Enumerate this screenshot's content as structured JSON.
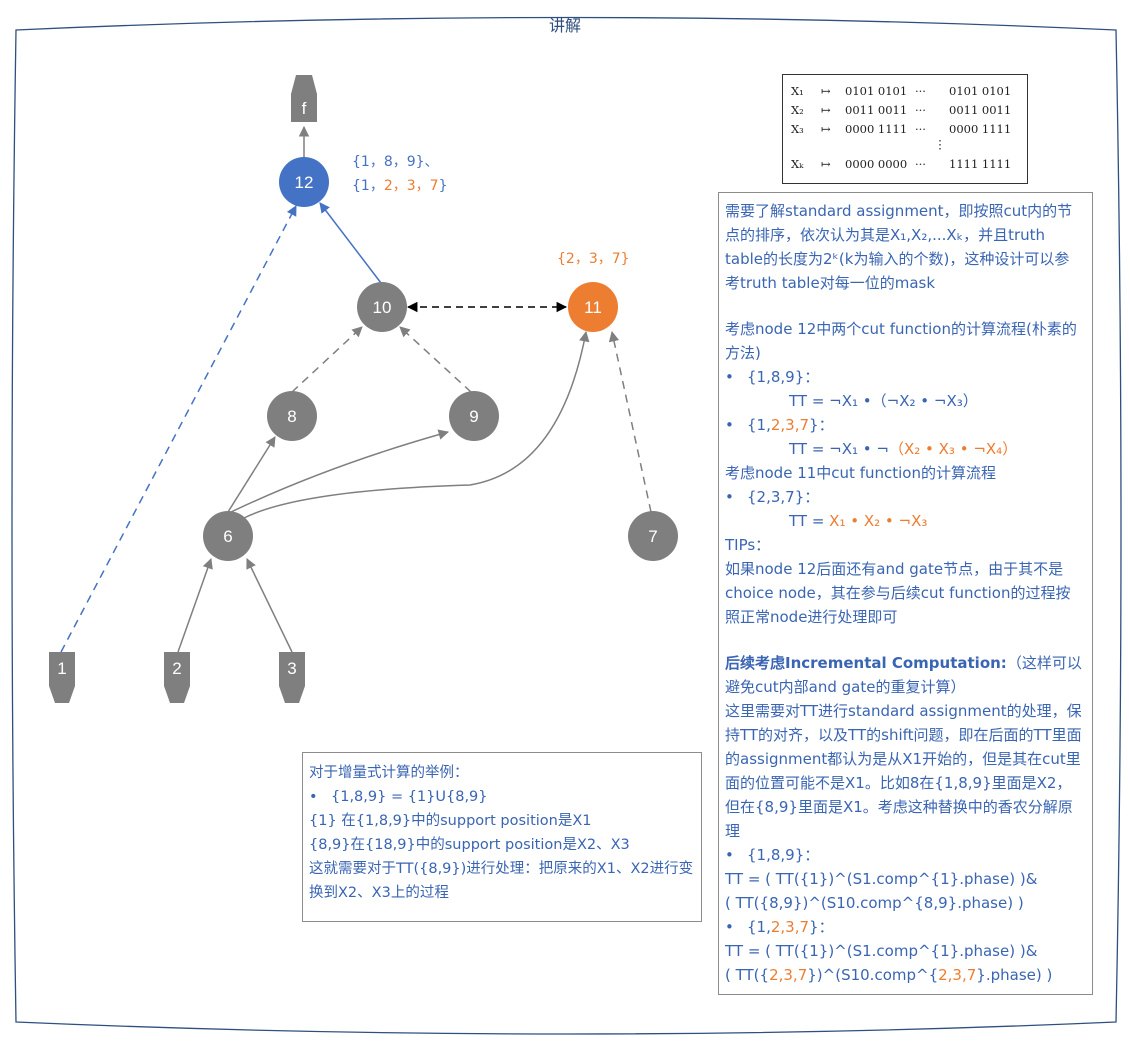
{
  "frame_title": "讲解",
  "graph": {
    "nodes": {
      "n12": "12",
      "n10": "10",
      "n11": "11",
      "n8": "8",
      "n9": "9",
      "n6": "6",
      "n7": "7",
      "i1": "1",
      "i2": "2",
      "i3": "3",
      "out": "f"
    },
    "cut_labels": {
      "cut12_a": "{1，8，9}、",
      "cut12_b_prefix": "{1，",
      "cut12_b_highlight": "2，3，7",
      "cut12_b_suffix": "}",
      "cut11": "{2，3，7}"
    }
  },
  "truth_table": {
    "rows": [
      {
        "var": "X₁",
        "arrow": "↦",
        "a": "0101 0101",
        "dots": "···",
        "b": "0101 0101"
      },
      {
        "var": "X₂",
        "arrow": "↦",
        "a": "0011 0011",
        "dots": "···",
        "b": "0011 0011"
      },
      {
        "var": "X₃",
        "arrow": "↦",
        "a": "0000 1111",
        "dots": "···",
        "b": "0000 1111"
      },
      {
        "var": "",
        "arrow": "",
        "a": "",
        "dots": "⋮",
        "b": ""
      },
      {
        "var": "Xₖ",
        "arrow": "↦",
        "a": "0000 0000",
        "dots": "···",
        "b": "1111 1111"
      }
    ]
  },
  "explanation": {
    "p1": "需要了解standard assignment，即按照cut内的节点的排序，依次认为其是X₁,X₂,...Xₖ，并且truth table的长度为2ᵏ(k为输入的个数)，这种设计可以参考truth table对每一位的mask",
    "p2": "考虑node 12中两个cut function的计算流程(朴素的方法)",
    "b1": "{1,8,9}：",
    "tt1": "TT =  ¬X₁ •（¬X₂ • ¬X₃）",
    "b2_prefix": "{1,",
    "b2_hl": "2,3,7",
    "b2_suffix": "}：",
    "tt2_prefix": "TT =  ¬X₁ • ¬",
    "tt2_hl": "（X₂ • X₃ • ¬X₄）",
    "p3": "考虑node 11中cut function的计算流程",
    "b3": "{2,3,7}：",
    "tt3_prefix": "TT = ",
    "tt3_hl": "X₁ • X₂ • ¬X₃",
    "tips": "TIPs：",
    "p4": "如果node 12后面还有and gate节点，由于其不是choice node，其在参与后续cut function的过程按照正常node进行处理即可",
    "p5_bold": "后续考虑Incremental Computation:",
    "p5_rest": "（这样可以避免cut内部and gate的重复计算）",
    "p6": "这里需要对TT进行standard assignment的处理，保持TT的对齐，以及TT的shift问题，即在后面的TT里面的assignment都认为是从X1开始的，但是其在cut里面的位置可能不是X1。比如8在{1,8,9}里面是X2，但在{8,9}里面是X1。考虑这种替换中的香农分解原理",
    "b4": "{1,8,9}：",
    "f1a": "TT = ( TT({1})^(S1.comp^{1}.phase) )&",
    "f1b": "( TT({8,9})^(S10.comp^{8,9}.phase) )",
    "b5_prefix": "{1,",
    "b5_hl": "2,3,7",
    "b5_suffix": "}：",
    "f2a": "TT = ( TT({1})^(S1.comp^{1}.phase) )&",
    "f2b_prefix": "( TT({",
    "f2b_hl1": "2,3,7",
    "f2b_mid": "})^(S10.comp^{",
    "f2b_hl2": "2,3,7",
    "f2b_suffix": "}.phase) )"
  },
  "example": {
    "l1": "对于增量式计算的举例：",
    "l2": "{1,8,9} = {1}U{8,9}",
    "l3": "{1} 在{1,8,9}中的support position是X1",
    "l4": "{8,9}在{18,9}中的support position是X2、X3",
    "l5": "这就需要对于TT({8,9})进行处理：把原来的X1、X2进行变换到X2、X3上的过程"
  },
  "colors": {
    "blue": "#4472c4",
    "orange": "#ed7d31",
    "gray": "#7f7f7f",
    "text_blue": "#3a65b3"
  }
}
